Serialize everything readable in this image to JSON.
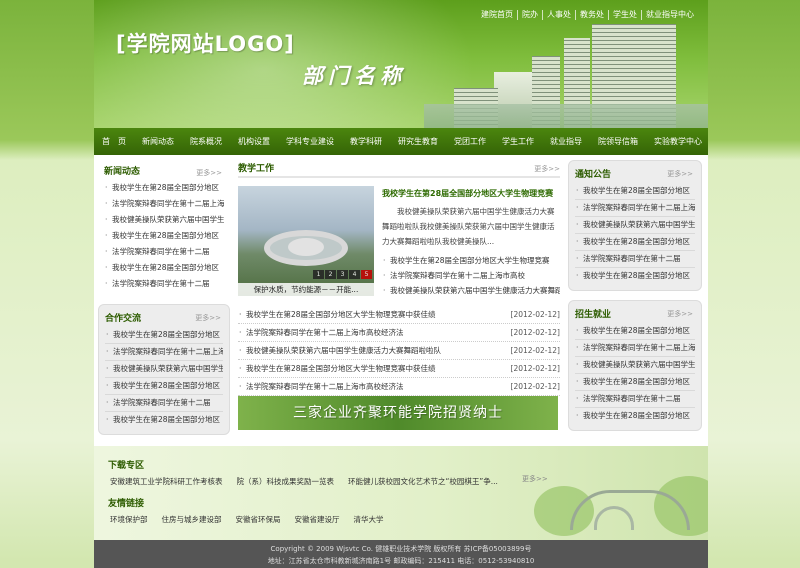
{
  "header": {
    "logo": "[学院网站LOGO]",
    "department": "部门名称",
    "top_links": [
      "建院首页",
      "院办",
      "人事处",
      "教务处",
      "学生处",
      "就业指导中心"
    ]
  },
  "nav": [
    "首　页",
    "新闻动态",
    "院系概况",
    "机构设置",
    "学科专业建设",
    "教学科研",
    "研究生教育",
    "党团工作",
    "学生工作",
    "就业指导",
    "院领导信箱",
    "实验教学中心"
  ],
  "more_label": "更多>>",
  "left": {
    "news": {
      "title": "新闻动态",
      "items": [
        "我校学生在第28届全国部分地区",
        "法学院案辩春同学在第十二届上海",
        "我校健美操队荣获第六届中国学生",
        "我校学生在第28届全国部分地区",
        "法学院案辩春同学在第十二届",
        "我校学生在第28届全国部分地区",
        "法学院案辩春同学在第十二届"
      ]
    },
    "coop": {
      "title": "合作交流",
      "items": [
        "我校学生在第28届全国部分地区",
        "法学院案辩春同学在第十二届上海",
        "我校健美操队荣获第六届中国学生",
        "我校学生在第28届全国部分地区",
        "法学院案辩春同学在第十二届",
        "我校学生在第28届全国部分地区"
      ]
    }
  },
  "middle": {
    "title": "教学工作",
    "photo_caption": "保护水质，节约能源－－开能...",
    "pager": [
      "1",
      "2",
      "3",
      "4",
      "5"
    ],
    "feature": {
      "title": "我校学生在第28届全国部分地区大学生物理竞赛",
      "text": "我校健美操队荣获第六届中国学生健康活力大赛舞蹈啦啦队我校健美操队荣获第六届中国学生健康活力大赛舞蹈啦啦队我校健美操队...",
      "items": [
        "我校学生在第28届全国部分地区大学生物理竞赛",
        "法学院案辩春同学在第十二届上海市高校",
        "我校健美操队荣获第六届中国学生健康活力大赛舞蹈"
      ]
    },
    "dated": [
      {
        "text": "我校学生在第28届全国部分地区大学生物理竞赛中获佳绩",
        "date": "[2012-02-12]"
      },
      {
        "text": "法学院案辩春同学在第十二届上海市高校经济法",
        "date": "[2012-02-12]"
      },
      {
        "text": "我校健美操队荣获第六届中国学生健康活力大赛舞蹈啦啦队",
        "date": "[2012-02-12]"
      },
      {
        "text": "我校学生在第28届全国部分地区大学生物理竞赛中获佳绩",
        "date": "[2012-02-12]"
      },
      {
        "text": "法学院案辩春同学在第十二届上海市高校经济法",
        "date": "[2012-02-12]"
      }
    ],
    "banner": "三家企业齐聚环能学院招贤纳士"
  },
  "right": {
    "notice": {
      "title": "通知公告",
      "items": [
        "我校学生在第28届全国部分地区",
        "法学院案辩春同学在第十二届上海",
        "我校健美操队荣获第六届中国学生",
        "我校学生在第28届全国部分地区",
        "法学院案辩春同学在第十二届",
        "我校学生在第28届全国部分地区"
      ]
    },
    "jobs": {
      "title": "招生就业",
      "items": [
        "我校学生在第28届全国部分地区",
        "法学院案辩春同学在第十二届上海",
        "我校健美操队荣获第六届中国学生",
        "我校学生在第28届全国部分地区",
        "法学院案辩春同学在第十二届",
        "我校学生在第28届全国部分地区"
      ]
    }
  },
  "download": {
    "title": "下载专区",
    "items": [
      "安徽建筑工业学院科研工作考核表",
      "院（系）科技成果奖励一览表",
      "环能健儿获校园文化艺术节之“校园棋王”争..."
    ]
  },
  "friends": {
    "title": "友情链接",
    "items": [
      "环境保护部",
      "住房与城乡建设部",
      "安徽省环保局",
      "安徽省建设厅",
      "清华大学"
    ]
  },
  "footer": {
    "line1": "Copyright © 2009 Wjsvtc Co. 健雄职业技术学院 版权所有 苏ICP备05003899号",
    "line2": "地址：江苏省太仓市科教新城济南路1号 邮政编码：215411 电话：0512-53940810"
  },
  "colors": {
    "brand_green": "#4b860e",
    "title_green": "#2d5c00",
    "pager_current": "#c60000",
    "footer_bg": "#555555"
  }
}
